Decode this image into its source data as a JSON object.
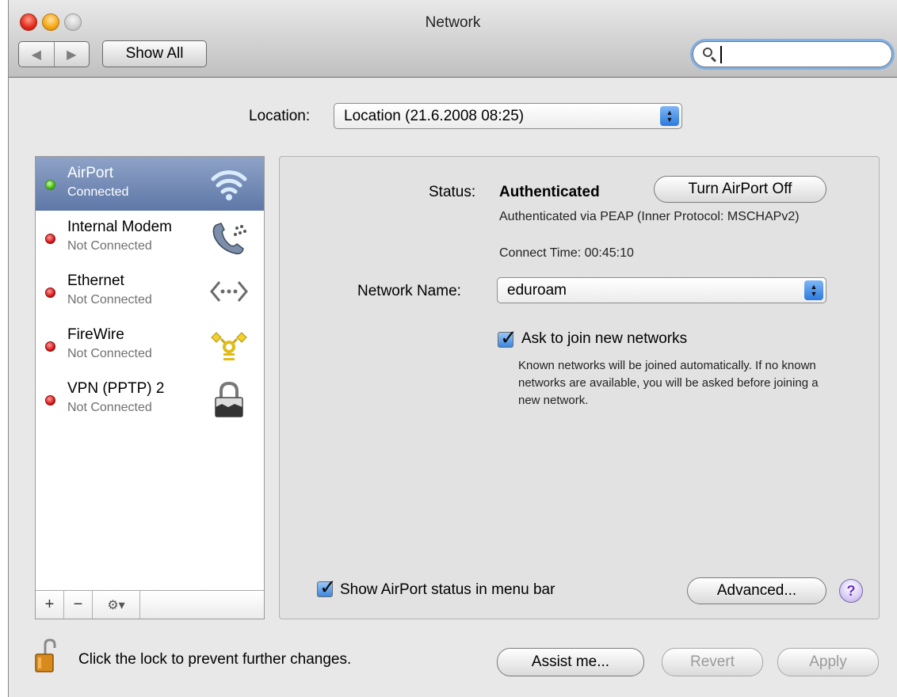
{
  "window": {
    "title": "Network"
  },
  "toolbar": {
    "back_glyph": "◀",
    "forward_glyph": "▶",
    "show_all_label": "Show All",
    "search_value": ""
  },
  "location": {
    "label": "Location:",
    "value": "Location (21.6.2008 08:25)"
  },
  "services": [
    {
      "name": "AirPort",
      "status": "Connected",
      "status_color": "green",
      "icon": "airport-wifi-icon",
      "selected": true
    },
    {
      "name": "Internal Modem",
      "status": "Not Connected",
      "status_color": "red",
      "icon": "modem-phone-icon",
      "selected": false
    },
    {
      "name": "Ethernet",
      "status": "Not Connected",
      "status_color": "red",
      "icon": "ethernet-icon",
      "selected": false
    },
    {
      "name": "FireWire",
      "status": "Not Connected",
      "status_color": "red",
      "icon": "firewire-icon",
      "selected": false
    },
    {
      "name": "VPN (PPTP) 2",
      "status": "Not Connected",
      "status_color": "red",
      "icon": "vpn-lock-icon",
      "selected": false
    }
  ],
  "list_toolbar": {
    "add": "+",
    "remove": "−",
    "gear": "⚙▾"
  },
  "detail": {
    "status_label": "Status:",
    "status_value": "Authenticated",
    "turn_off_label": "Turn AirPort Off",
    "status_detail": "Authenticated via PEAP (Inner Protocol: MSCHAPv2)",
    "connect_time": "Connect Time: 00:45:10",
    "network_name_label": "Network Name:",
    "network_name_value": "eduroam",
    "ask_join_label": "Ask to join new networks",
    "ask_join_checked": true,
    "ask_join_help": "Known networks will be joined automatically. If no known networks are available, you will be asked before joining a new network.",
    "show_status_label": "Show AirPort status in menu bar",
    "show_status_checked": true,
    "advanced_label": "Advanced...",
    "help_label": "?"
  },
  "footer": {
    "lock_text": "Click the lock to prevent further changes.",
    "assist_label": "Assist me...",
    "revert_label": "Revert",
    "apply_label": "Apply"
  },
  "colors": {
    "selection": "#5e77a6",
    "status_green": "#3cb30e",
    "status_red": "#d41212",
    "accent_blue": "#3c86e0"
  }
}
